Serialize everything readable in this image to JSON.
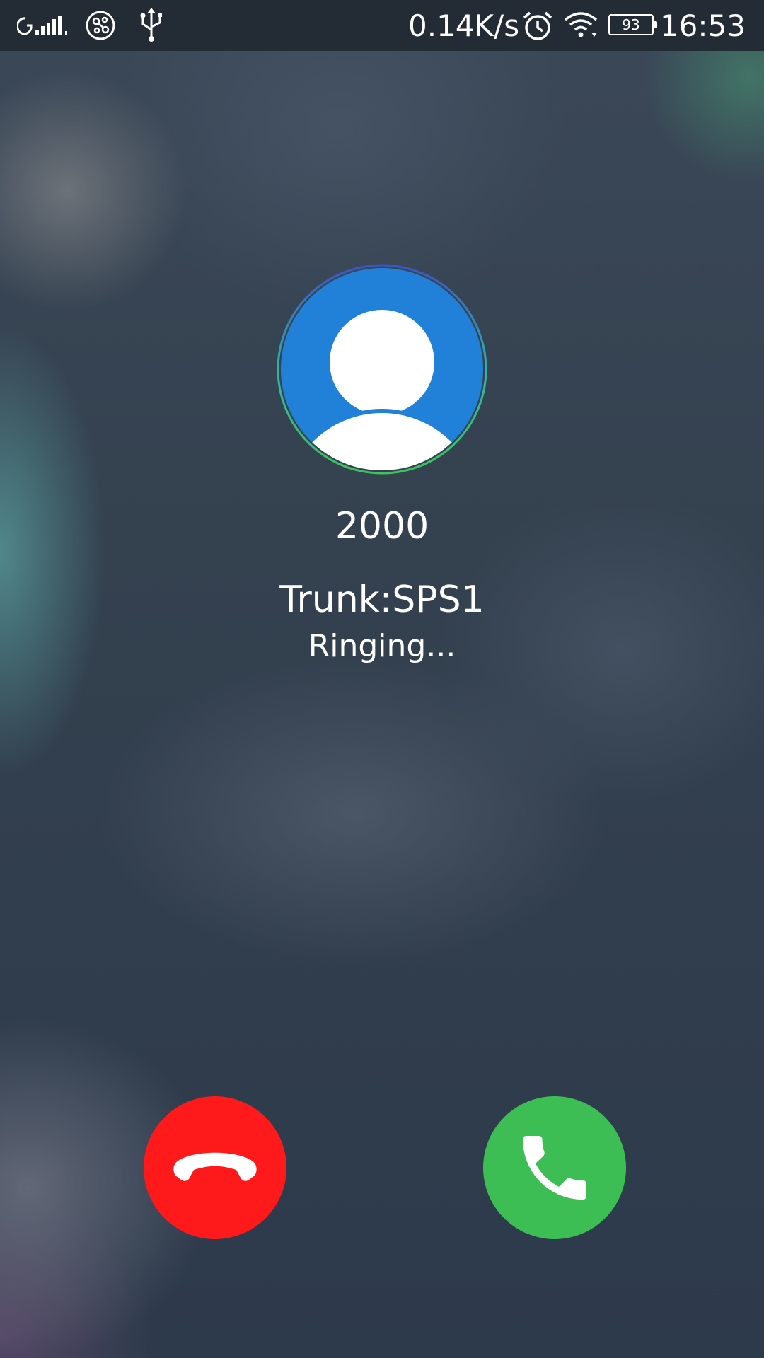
{
  "status_bar": {
    "network_speed": "0.14K/s",
    "battery_level": "93",
    "time": "16:53",
    "icons": [
      "signal-icon",
      "share-icon",
      "usb-icon",
      "alarm-icon",
      "wifi-icon",
      "battery-icon"
    ]
  },
  "call": {
    "number": "2000",
    "trunk": "Trunk:SPS1",
    "status": "Ringing..."
  },
  "actions": {
    "decline_icon": "decline-call-icon",
    "answer_icon": "answer-call-icon"
  },
  "colors": {
    "avatar_background": "#2181d8",
    "decline": "#fe1a1a",
    "answer": "#3dbe55"
  }
}
